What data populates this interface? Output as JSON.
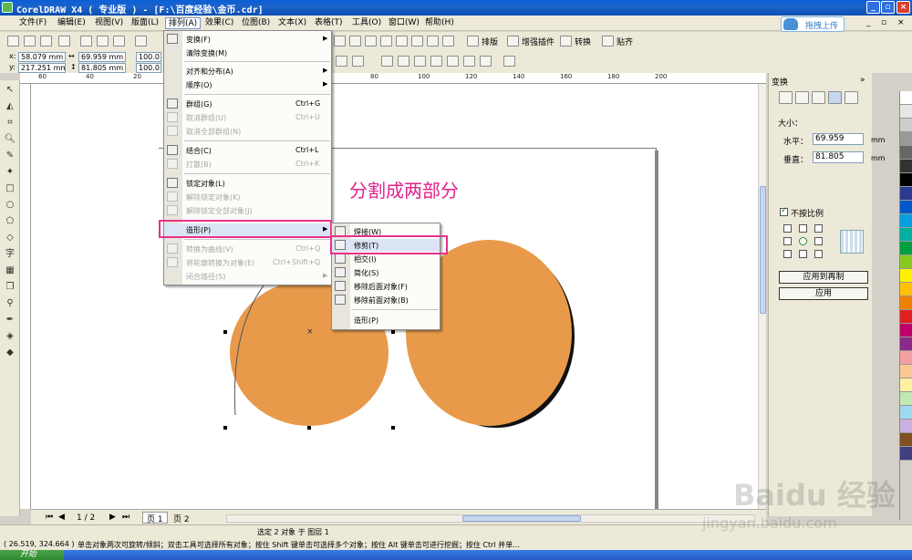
{
  "titlebar": {
    "title": "CorelDRAW X4 ( 专业版 ) - [F:\\百度经验\\金币.cdr]"
  },
  "upload": {
    "label": "拖拽上传"
  },
  "menubar": {
    "items": [
      {
        "label": "文件(F)",
        "key": "file"
      },
      {
        "label": "编辑(E)",
        "key": "edit"
      },
      {
        "label": "视图(V)",
        "key": "view"
      },
      {
        "label": "版面(L)",
        "key": "layout"
      },
      {
        "label": "排列(A)",
        "key": "arrange"
      },
      {
        "label": "效果(C)",
        "key": "effects"
      },
      {
        "label": "位图(B)",
        "key": "bitmaps"
      },
      {
        "label": "文本(X)",
        "key": "text"
      },
      {
        "label": "表格(T)",
        "key": "table"
      },
      {
        "label": "工具(O)",
        "key": "tools"
      },
      {
        "label": "窗口(W)",
        "key": "window"
      },
      {
        "label": "帮助(H)",
        "key": "help"
      }
    ]
  },
  "toolbar": {
    "labels": {
      "paiban": "排版",
      "zengqiang": "增强插件",
      "zhuanhuan": "转换",
      "tieqi": "贴齐"
    }
  },
  "propbar": {
    "x": "58.079 mm",
    "y": "217.251 mm",
    "width": "69.959 mm",
    "height": "81.805 mm",
    "scale_x": "100.0",
    "scale_y": "100.0",
    "x_label": "x:",
    "y_label": "y:"
  },
  "ruler": {
    "h_ticks": [
      "60",
      "40",
      "20",
      "0",
      "20",
      "40",
      "60",
      "80",
      "100",
      "120",
      "140",
      "160",
      "180",
      "200"
    ]
  },
  "canvas": {
    "annotation": "分割成两部分"
  },
  "colors": {
    "circle_fill": "#e89a4a",
    "highlight": "#e8318a",
    "annotation": "#e0218a"
  },
  "arrange_menu": {
    "items": [
      {
        "label": "变换(F)",
        "shortcut": "",
        "disabled": false,
        "submenu": true
      },
      {
        "label": "清除变换(M)",
        "shortcut": "",
        "disabled": false,
        "submenu": false
      },
      {
        "label": "对齐和分布(A)",
        "shortcut": "",
        "disabled": false,
        "submenu": true
      },
      {
        "label": "顺序(O)",
        "shortcut": "",
        "disabled": false,
        "submenu": true
      },
      {
        "label": "群组(G)",
        "shortcut": "Ctrl+G",
        "disabled": false,
        "submenu": false
      },
      {
        "label": "取消群组(U)",
        "shortcut": "Ctrl+U",
        "disabled": true,
        "submenu": false
      },
      {
        "label": "取消全部群组(N)",
        "shortcut": "",
        "disabled": true,
        "submenu": false
      },
      {
        "label": "结合(C)",
        "shortcut": "Ctrl+L",
        "disabled": false,
        "submenu": false
      },
      {
        "label": "打散(B)",
        "shortcut": "Ctrl+K",
        "disabled": true,
        "submenu": false
      },
      {
        "label": "锁定对象(L)",
        "shortcut": "",
        "disabled": false,
        "submenu": false
      },
      {
        "label": "解除锁定对象(K)",
        "shortcut": "",
        "disabled": true,
        "submenu": false
      },
      {
        "label": "解除锁定全部对象(J)",
        "shortcut": "",
        "disabled": true,
        "submenu": false
      },
      {
        "label": "造形(P)",
        "shortcut": "",
        "disabled": false,
        "submenu": true
      },
      {
        "label": "转换为曲线(V)",
        "shortcut": "Ctrl+Q",
        "disabled": true,
        "submenu": false
      },
      {
        "label": "将轮廓转换为对象(E)",
        "shortcut": "Ctrl+Shift+Q",
        "disabled": true,
        "submenu": false
      },
      {
        "label": "闭合路径(S)",
        "shortcut": "",
        "disabled": true,
        "submenu": true
      }
    ]
  },
  "shaping_menu": {
    "items": [
      {
        "label": "焊接(W)"
      },
      {
        "label": "修剪(T)"
      },
      {
        "label": "相交(I)"
      },
      {
        "label": "简化(S)"
      },
      {
        "label": "移除后面对象(F)"
      },
      {
        "label": "移除前面对象(B)"
      },
      {
        "label": "造形(P)"
      }
    ]
  },
  "docker": {
    "title": "变换",
    "size_label": "大小：",
    "h_label": "水平：",
    "h_value": "69.959",
    "v_label": "垂直：",
    "v_value": "81.805",
    "unit": "mm",
    "proportional": "不按比例",
    "apply_copy": "应用到再制",
    "apply": "应用"
  },
  "pagebar": {
    "page_count": "1 / 2",
    "tab1": "页 1",
    "tab2": "页 2"
  },
  "status": {
    "selection": "选定 2 对象 于 图层 1",
    "coords": "( 26.519, 324.664 )",
    "hint": "单击对象两次可旋转/倾斜；双击工具可选择所有对象；按住 Shift 键单击可选择多个对象；按住 Alt 键单击可进行挖掘；按住 Ctrl 并单..."
  },
  "taskbar": {
    "start": "开始"
  },
  "watermark": {
    "main": "Baidu 经验",
    "sub": "jingyan.baidu.com"
  }
}
